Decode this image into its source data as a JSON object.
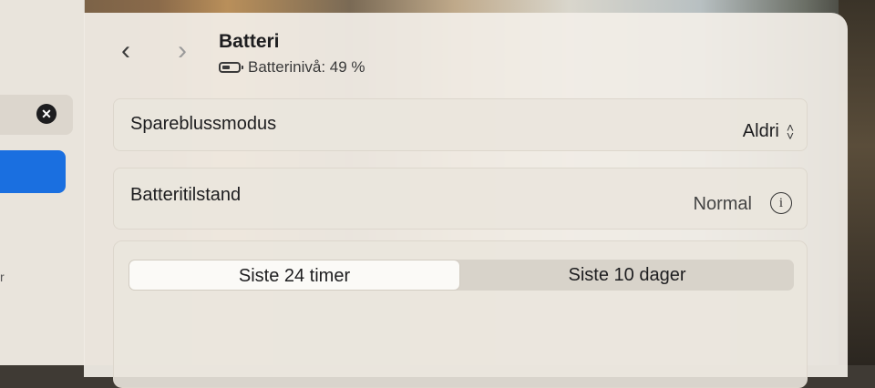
{
  "header": {
    "title": "Batteri",
    "subtitle": "Batterinivå: 49 %"
  },
  "battery": {
    "level_fraction": 0.49
  },
  "rows": {
    "low_power": {
      "label": "Spareblussmodus",
      "value": "Aldri"
    },
    "health": {
      "label": "Batteritilstand",
      "value": "Normal"
    }
  },
  "segments": {
    "left": "Siste 24 timer",
    "right": "Siste 10 dager",
    "selected": "Siste 24 timer"
  },
  "sidebar": {
    "stray_text": "r"
  },
  "icons": {
    "back": "chevron-left-icon",
    "forward": "chevron-right-icon",
    "battery": "battery-icon",
    "info": "info-icon",
    "clear": "clear-search-icon",
    "popup": "updown-chevron-icon"
  },
  "colors": {
    "accent": "#1a6fe0",
    "window_bg": "#f2eee7",
    "text": "#1d1d1f"
  }
}
